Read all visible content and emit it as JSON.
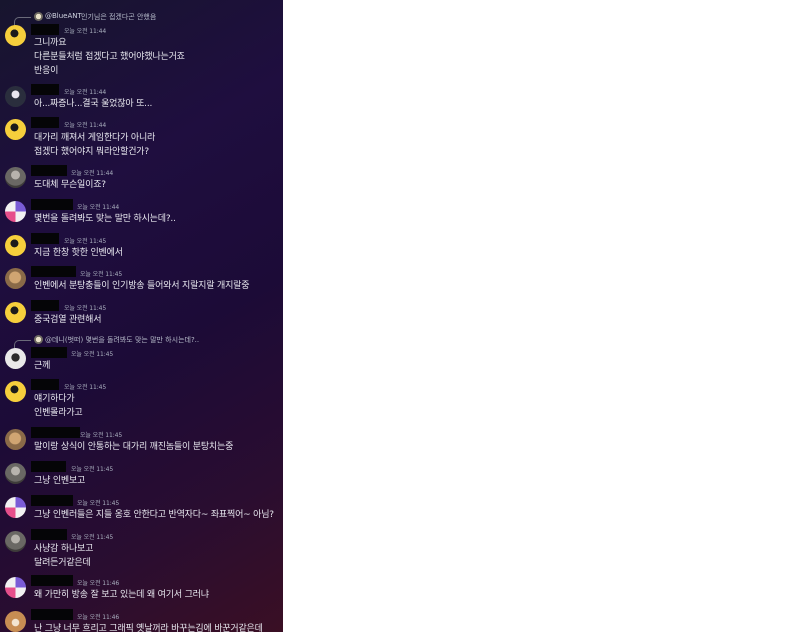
{
  "messages": [
    {
      "reply": {
        "author": "@BlueANT",
        "text": "인기님은 접겠다곤 안했음"
      },
      "time": "오늘 오전 11:44",
      "lines": [
        "그니까요",
        "다른분들처럼 접겠다고 했어야했나는거죠",
        "반응이"
      ]
    },
    {
      "time": "오늘 오전 11:44",
      "lines": [
        "아...짜증나...결국 울었잖아 또..."
      ]
    },
    {
      "time": "오늘 오전 11:44",
      "lines": [
        "대가리 깨져서 게임한다가 아니라",
        "접겠다 했어야지 뭐라안할건가?"
      ]
    },
    {
      "time": "오늘 오전 11:44",
      "lines": [
        "도대체 무슨일이죠?"
      ]
    },
    {
      "time": "오늘 오전 11:44",
      "lines": [
        "몇번을 돌려봐도 맞는 말만 하시는데?.."
      ]
    },
    {
      "time": "오늘 오전 11:45",
      "lines": [
        "지금 한창 핫한 인벤에서"
      ]
    },
    {
      "time": "오늘 오전 11:45",
      "lines": [
        "인벤에서 분탕충들이 인기방송 들어와서 지랄지랄 개지랄중"
      ]
    },
    {
      "time": "오늘 오전 11:45",
      "lines": [
        "중국검열 관련해서"
      ]
    },
    {
      "reply": {
        "author": "",
        "text": "@데니(벗떠) 몇번을 돌려봐도 맞는 말만 하시는데?.."
      },
      "time": "오늘 오전 11:45",
      "lines": [
        "근께"
      ]
    },
    {
      "time": "오늘 오전 11:45",
      "lines": [
        "얘기하다가",
        "인벤몰라가고"
      ]
    },
    {
      "time": "오늘 오전 11:45",
      "lines": [
        "말이랑 상식이 안통하는 대가리 깨진놈들이 분탕치는중"
      ]
    },
    {
      "time": "오늘 오전 11:45",
      "lines": [
        "그냥 인벤보고"
      ]
    },
    {
      "time": "오늘 오전 11:45",
      "lines": [
        "그냥 인벤러들은 지들 옹호 안한다고 반역자다~ 좌표찍어~ 아님?"
      ]
    },
    {
      "time": "오늘 오전 11:45",
      "lines": [
        "사냥감 하나보고",
        "달려든거같은데"
      ]
    },
    {
      "time": "오늘 오전 11:46",
      "lines": [
        "왜 가만히 방송 잘 보고 있는데 왜 여기서 그러냐"
      ]
    },
    {
      "time": "오늘 오전 11:46",
      "lines": [
        "난 그냥 너무 흐리고 그래픽 옛날꺼라 바꾸는김에 바꾼거같은데"
      ]
    }
  ]
}
